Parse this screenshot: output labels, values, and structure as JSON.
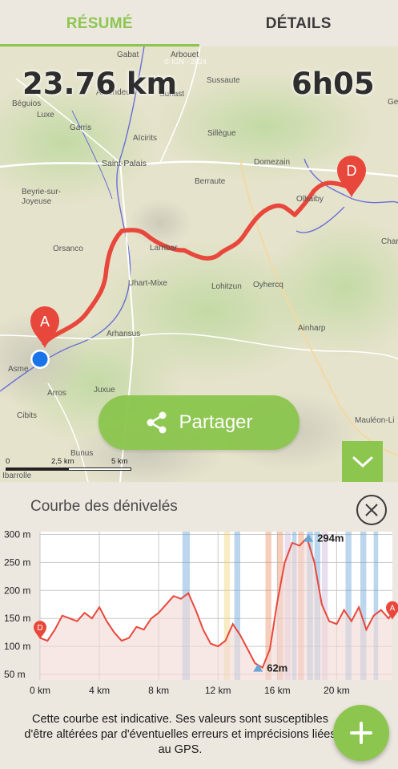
{
  "tabs": [
    {
      "label": "RÉSUMÉ",
      "active": true
    },
    {
      "label": "DÉTAILS",
      "active": false
    }
  ],
  "map": {
    "distance": "23.76 km",
    "duration": "6h05",
    "attribution": "© IGN - 2024",
    "places": [
      "Gabat",
      "Arbouet",
      "Amendeuix",
      "Sussaute",
      "Béguios",
      "Suhast",
      "Luxe",
      "Garris",
      "Aïcirits",
      "Sillègue",
      "Saint-Palais",
      "Domezain",
      "Beyrie-sur-Joyeuse",
      "Berraute",
      "Olhaiby",
      "Orsanco",
      "Larribar",
      "Uhart-Mixe",
      "Lohitzun",
      "Oyhercq",
      "Arhansus",
      "Ainharp",
      "Asme",
      "Arros",
      "Juxue",
      "Cibits",
      "Bunus",
      "Ibarrolle",
      "Mauléon-Li",
      "Charr",
      "Ge"
    ],
    "marker_start": "A",
    "marker_end": "D",
    "scale_labels": [
      "0",
      "2,5 km",
      "5 km"
    ],
    "share_label": "Partager",
    "share_icon": "share-icon",
    "collapse_icon": "chevron-down-icon"
  },
  "profile": {
    "title": "Courbe des dénivelés",
    "close_icon": "close-icon",
    "note": "Cette courbe est indicative. Ses valeurs sont susceptibles d'être altérées par d'éventuelles erreurs et imprécisions liées au GPS.",
    "add_icon": "plus-icon",
    "colors": {
      "accent": "#8cc64f",
      "line": "#e8483b",
      "bands": [
        "#6aa6d6",
        "#e8926a",
        "#f2d27a",
        "#c9b6d9"
      ]
    }
  },
  "chart_data": {
    "type": "line",
    "title": "",
    "xlabel": "",
    "ylabel": "",
    "x_ticks": [
      "0 km",
      "4 km",
      "8 km",
      "12 km",
      "16 km",
      "20 km"
    ],
    "y_ticks": [
      "50 m",
      "100 m",
      "150 m",
      "200 m",
      "250 m",
      "300 m"
    ],
    "xlim": [
      0,
      23.76
    ],
    "ylim": [
      40,
      305
    ],
    "x": [
      0,
      0.5,
      1,
      1.5,
      2,
      2.5,
      3,
      3.5,
      4,
      4.5,
      5,
      5.5,
      6,
      6.5,
      7,
      7.5,
      8,
      8.5,
      9,
      9.5,
      10,
      10.5,
      11,
      11.5,
      12,
      12.5,
      13,
      13.5,
      14,
      14.5,
      15,
      15.5,
      16,
      16.5,
      17,
      17.5,
      18,
      18.5,
      19,
      19.5,
      20,
      20.5,
      21,
      21.5,
      22,
      22.5,
      23,
      23.5,
      23.76
    ],
    "y": [
      115,
      110,
      130,
      155,
      150,
      145,
      160,
      150,
      170,
      145,
      125,
      110,
      115,
      135,
      130,
      150,
      160,
      175,
      190,
      185,
      195,
      165,
      130,
      105,
      100,
      110,
      140,
      120,
      95,
      70,
      62,
      95,
      180,
      250,
      285,
      280,
      294,
      250,
      175,
      145,
      140,
      165,
      145,
      170,
      130,
      155,
      165,
      150,
      160
    ],
    "annotations": [
      {
        "label": "294m",
        "x": 18.1,
        "y": 294
      },
      {
        "label": "62m",
        "x": 14.7,
        "y": 62
      }
    ],
    "markers": [
      {
        "label": "D",
        "x": 0,
        "y": 130
      },
      {
        "label": "A",
        "x": 23.76,
        "y": 165
      }
    ],
    "grid": true
  }
}
